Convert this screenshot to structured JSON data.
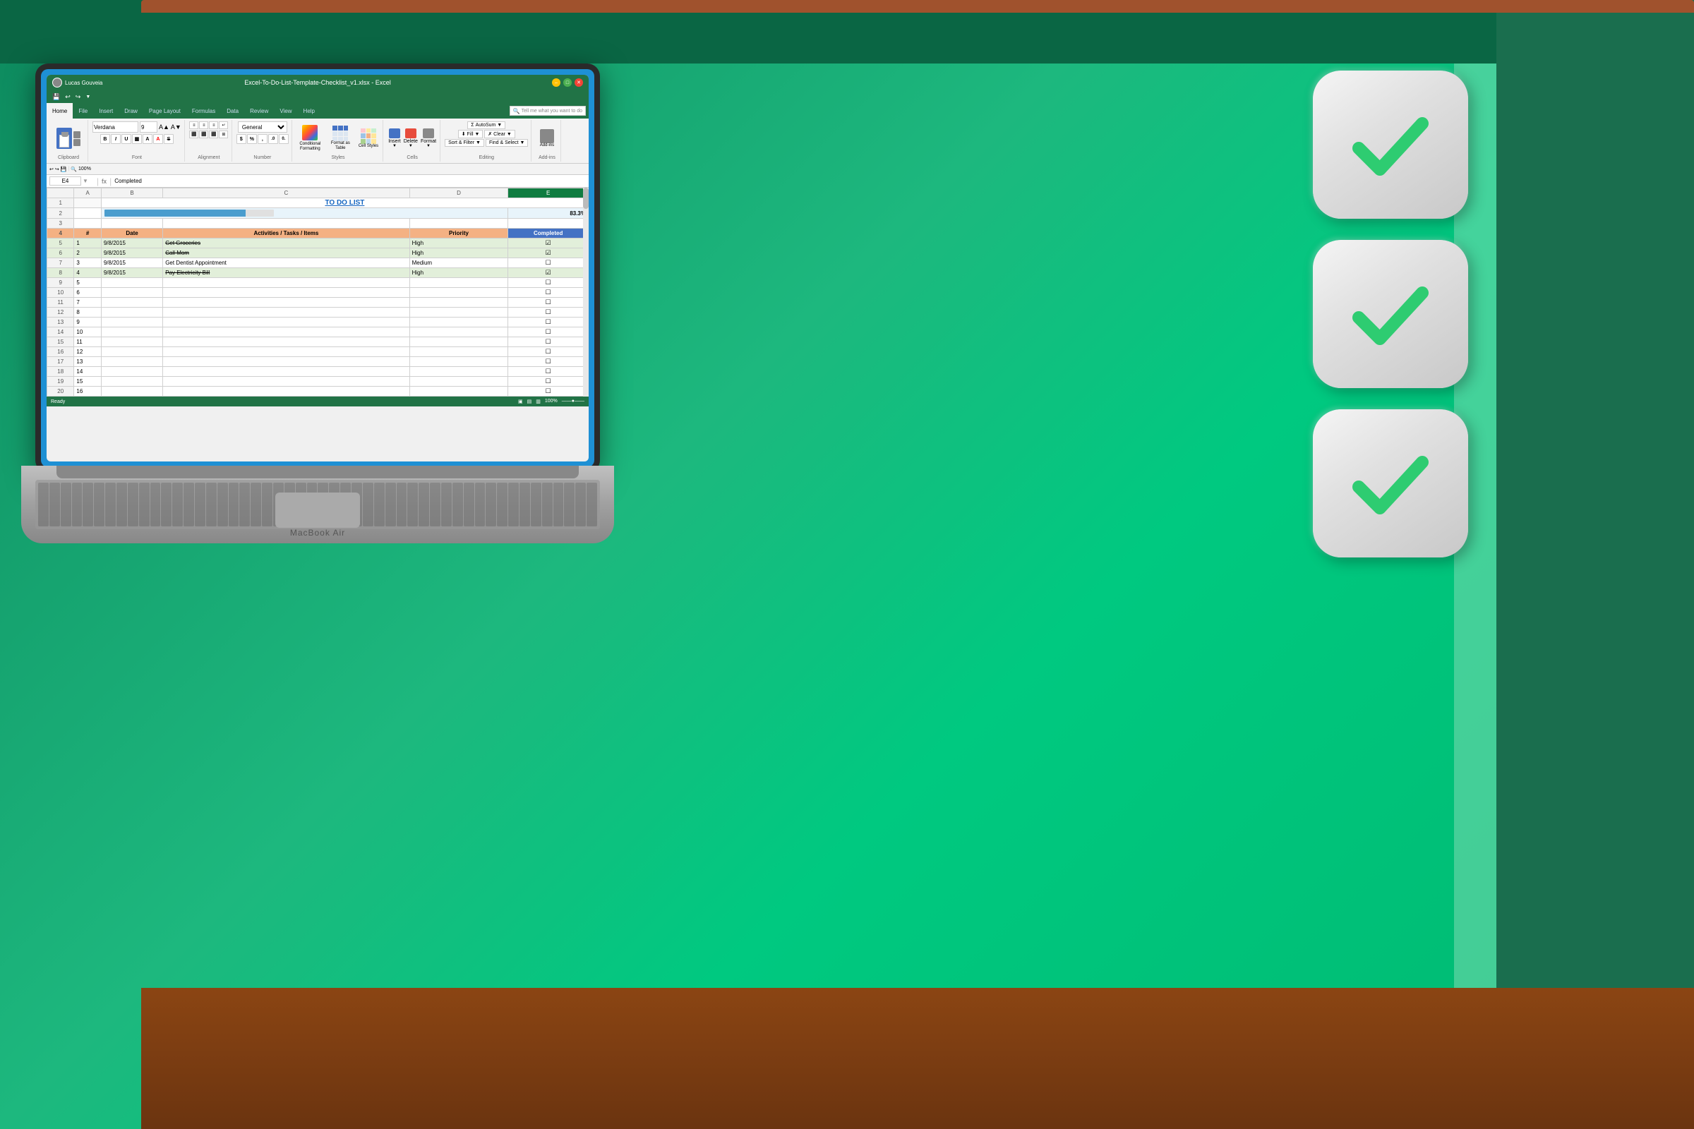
{
  "background": {
    "color": "#1a9e6e",
    "topBar": "#0a6644"
  },
  "window": {
    "title": "Excel-To-Do-List-Template-Checklist_v1.xlsx - Excel",
    "user": "Lucas Gouveia",
    "controls": [
      "minimize",
      "maximize",
      "close"
    ]
  },
  "ribbon": {
    "tabs": [
      "File",
      "Home",
      "Insert",
      "Draw",
      "Page Layout",
      "Formulas",
      "Data",
      "Review",
      "View",
      "Help"
    ],
    "activeTab": "Home",
    "quickAccess": [
      "save",
      "undo",
      "redo"
    ],
    "groups": {
      "clipboard": {
        "label": "Clipboard",
        "buttons": [
          "Paste",
          "Cut",
          "Copy",
          "Format Painter"
        ]
      },
      "font": {
        "label": "Font",
        "name": "Verdana",
        "size": "9",
        "buttons": [
          "Bold",
          "Italic",
          "Underline"
        ]
      },
      "alignment": {
        "label": "Alignment"
      },
      "number": {
        "label": "Number",
        "format": "General"
      },
      "styles": {
        "label": "Styles",
        "conditionalFormatting": "Conditional Formatting",
        "formatAsTable": "Format as Table",
        "cellStyles": "Cell Styles"
      },
      "cells": {
        "label": "Cells",
        "insert": "Insert",
        "delete": "Delete",
        "format": "Format"
      },
      "editing": {
        "label": "Editing",
        "autoSum": "AutoSum",
        "fill": "Fill",
        "sortFilter": "Sort & Filter",
        "findSelect": "Find & Select ~"
      },
      "addins": {
        "label": "Add-ins",
        "button": "Add-ins"
      }
    }
  },
  "formulaBar": {
    "cellRef": "E4",
    "formula": "Completed"
  },
  "spreadsheet": {
    "title": "TO DO LIST",
    "progressPercent": "83.3%",
    "progressBarWidth": 83.3,
    "headers": [
      "#",
      "Date",
      "Activities / Tasks / Items",
      "Priority",
      "Completed"
    ],
    "rows": [
      {
        "rowNum": 1,
        "num": "1",
        "date": "9/8/2015",
        "task": "Get Groceries",
        "priority": "High",
        "completed": true,
        "strikethrough": true,
        "highlight": true
      },
      {
        "rowNum": 2,
        "num": "2",
        "date": "9/8/2015",
        "task": "Call Mom",
        "priority": "High",
        "completed": true,
        "strikethrough": true,
        "highlight": true
      },
      {
        "rowNum": 3,
        "num": "3",
        "date": "9/8/2015",
        "task": "Get Dentist Appointment",
        "priority": "Medium",
        "completed": false,
        "strikethrough": false,
        "highlight": false
      },
      {
        "rowNum": 4,
        "num": "4",
        "date": "9/8/2015",
        "task": "Pay Electricity Bill",
        "priority": "High",
        "completed": true,
        "strikethrough": true,
        "highlight": true
      },
      {
        "rowNum": 5,
        "num": "5",
        "date": "",
        "task": "",
        "priority": "",
        "completed": false,
        "strikethrough": false,
        "highlight": false
      },
      {
        "rowNum": 6,
        "num": "6",
        "date": "",
        "task": "",
        "priority": "",
        "completed": false,
        "strikethrough": false,
        "highlight": false
      },
      {
        "rowNum": 7,
        "num": "7",
        "date": "",
        "task": "",
        "priority": "",
        "completed": false,
        "strikethrough": false,
        "highlight": false
      },
      {
        "rowNum": 8,
        "num": "8",
        "date": "",
        "task": "",
        "priority": "",
        "completed": false,
        "strikethrough": false,
        "highlight": false
      },
      {
        "rowNum": 9,
        "num": "9",
        "date": "",
        "task": "",
        "priority": "",
        "completed": false,
        "strikethrough": false,
        "highlight": false
      },
      {
        "rowNum": 10,
        "num": "10",
        "date": "",
        "task": "",
        "priority": "",
        "completed": false,
        "strikethrough": false,
        "highlight": false
      },
      {
        "rowNum": 11,
        "num": "11",
        "date": "",
        "task": "",
        "priority": "",
        "completed": false,
        "strikethrough": false,
        "highlight": false
      },
      {
        "rowNum": 12,
        "num": "12",
        "date": "",
        "task": "",
        "priority": "",
        "completed": false,
        "strikethrough": false,
        "highlight": false
      },
      {
        "rowNum": 13,
        "num": "13",
        "date": "",
        "task": "",
        "priority": "",
        "completed": false,
        "strikethrough": false,
        "highlight": false
      },
      {
        "rowNum": 14,
        "num": "14",
        "date": "",
        "task": "",
        "priority": "",
        "completed": false,
        "strikethrough": false,
        "highlight": false
      },
      {
        "rowNum": 15,
        "num": "15",
        "date": "",
        "task": "",
        "priority": "",
        "completed": false,
        "strikethrough": false,
        "highlight": false
      },
      {
        "rowNum": 16,
        "num": "16",
        "date": "",
        "task": "",
        "priority": "",
        "completed": false,
        "strikethrough": false,
        "highlight": false
      }
    ],
    "columnHeaders": [
      "",
      "B",
      "C",
      "D",
      "E"
    ],
    "spreadsheetRows": [
      1,
      2,
      3,
      4,
      5,
      6,
      7,
      8,
      9,
      10,
      11,
      12,
      13,
      14,
      15,
      16,
      17,
      18,
      19,
      20
    ]
  },
  "laptop": {
    "brand": "MacBook Air"
  },
  "checkmarks": [
    {
      "id": 1
    },
    {
      "id": 2
    },
    {
      "id": 3
    }
  ],
  "tellMeBox": {
    "placeholder": "Tell me what you want to do"
  }
}
